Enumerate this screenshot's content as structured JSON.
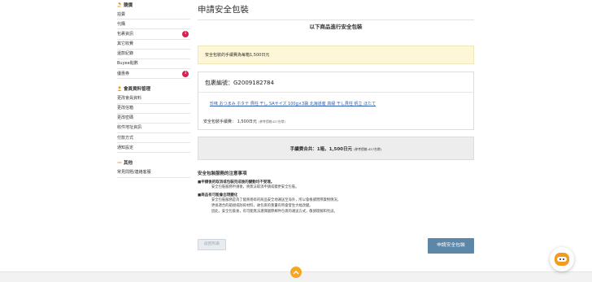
{
  "sidebar": {
    "sections": [
      {
        "title": "競價",
        "items": [
          {
            "label": "拍賣",
            "badge": ""
          },
          {
            "label": "代購",
            "badge": ""
          },
          {
            "label": "包裹資訊",
            "badge": "1"
          },
          {
            "label": "其它收費",
            "badge": ""
          },
          {
            "label": "還款紀錄",
            "badge": ""
          },
          {
            "label": "Buyee點數",
            "badge": ""
          },
          {
            "label": "優惠券",
            "badge": "3"
          }
        ]
      },
      {
        "title": "會員資料管理",
        "items": [
          {
            "label": "更改會員資料",
            "badge": ""
          },
          {
            "label": "更改信箱",
            "badge": ""
          },
          {
            "label": "更改密碼",
            "badge": ""
          },
          {
            "label": "收件地址資訊",
            "badge": ""
          },
          {
            "label": "付款方式",
            "badge": ""
          },
          {
            "label": "通知設定",
            "badge": ""
          }
        ]
      },
      {
        "title": "其他",
        "items": [
          {
            "label": "常見問題/連絡客服",
            "badge": ""
          }
        ]
      }
    ]
  },
  "main": {
    "title": "申請安全包裝",
    "subtitle": "以下商品進行安全包裝",
    "notice": "安全包裝的手續費為每箱1,500日元",
    "package": {
      "number": "包裹編號：G2009182784",
      "item_link": "珍味 おつまみ ホタテ 貝柱 干し SAサイズ 100g×3袋 北海道産 高級 干し貝柱 帆立 ほたて",
      "fee": "安全包裝手續費： 1,500日元",
      "fee_ref": "(參考價格427台幣)"
    },
    "total": "手續費合共：1箱，1,500日元",
    "total_ref": "(參考價格:427台幣)",
    "cautions": {
      "title": "安全包裝服務的注意事項",
      "blocks": [
        {
          "head": "■申請後的取消或包裝完成後的變動均不受理。",
          "lines": [
            "安全包裝服務申請後，將無法取消申請或變更安全包裝。"
          ]
        },
        {
          "head": "■商品有可能會出現變化",
          "lines": [
            "安全包裝服務是為了能將易碎的商品安全地運送至海外，所以會根據實際貨物情況，",
            "更換適合的箱規或防碎材料，故包裹的重量有時會發生大幅改變。",
            "因此，安全包裝後，有可能無法選擇國際郵件包裹的運送方式，敬請理解和見諒。"
          ]
        }
      ]
    },
    "back_label": "返回列表",
    "apply_label": "申請安全包裝"
  },
  "colors": {
    "notice_bg": "#fdf7d7",
    "primary_button": "#5d87a7",
    "badge": "#d6204f",
    "scroll_top": "#f5a623",
    "chat": "#f29a1f"
  },
  "icons": {
    "scroll_top": "chevron-up-icon",
    "chat": "chatbot-icon"
  }
}
